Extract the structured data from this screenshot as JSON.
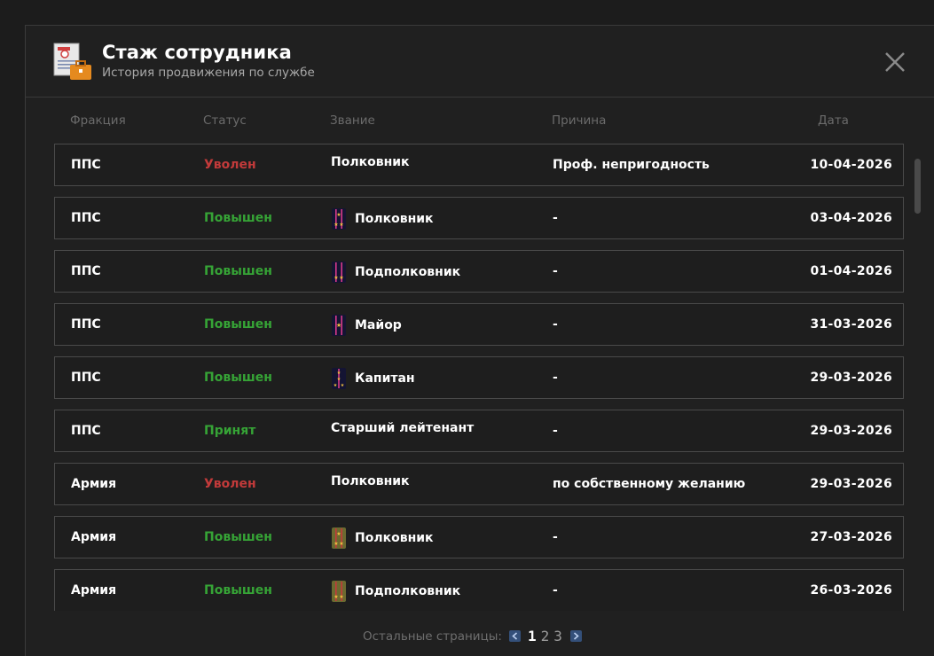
{
  "header": {
    "title": "Стаж сотрудника",
    "subtitle": "История продвижения по службе",
    "icon": "document-briefcase-icon"
  },
  "columns": {
    "faction": "Фракция",
    "status": "Статус",
    "rank": "Звание",
    "reason": "Причина",
    "date": "Дата"
  },
  "rows": [
    {
      "faction": "ППС",
      "status": "Уволен",
      "status_type": "fired",
      "rank": "Полковник",
      "rank_icon": "none",
      "reason": "Проф. непригодность",
      "date": "10-04-2026"
    },
    {
      "faction": "ППС",
      "status": "Повышен",
      "status_type": "promoted",
      "rank": "Полковник",
      "rank_icon": "police-colonel-epaulette",
      "reason": "-",
      "date": "03-04-2026"
    },
    {
      "faction": "ППС",
      "status": "Повышен",
      "status_type": "promoted",
      "rank": "Подполковник",
      "rank_icon": "police-lt-colonel-epaulette",
      "reason": "-",
      "date": "01-04-2026"
    },
    {
      "faction": "ППС",
      "status": "Повышен",
      "status_type": "promoted",
      "rank": "Майор",
      "rank_icon": "police-major-epaulette",
      "reason": "-",
      "date": "31-03-2026"
    },
    {
      "faction": "ППС",
      "status": "Повышен",
      "status_type": "promoted",
      "rank": "Капитан",
      "rank_icon": "police-captain-epaulette",
      "reason": "-",
      "date": "29-03-2026"
    },
    {
      "faction": "ППС",
      "status": "Принят",
      "status_type": "hired",
      "rank": "Старший лейтенант",
      "rank_icon": "none",
      "reason": "-",
      "date": "29-03-2026"
    },
    {
      "faction": "Армия",
      "status": "Уволен",
      "status_type": "fired",
      "rank": "Полковник",
      "rank_icon": "none",
      "reason": "по собственному желанию",
      "date": "29-03-2026"
    },
    {
      "faction": "Армия",
      "status": "Повышен",
      "status_type": "promoted",
      "rank": "Полковник",
      "rank_icon": "army-colonel-epaulette",
      "reason": "-",
      "date": "27-03-2026"
    },
    {
      "faction": "Армия",
      "status": "Повышен",
      "status_type": "promoted",
      "rank": "Подполковник",
      "rank_icon": "army-lt-colonel-epaulette",
      "reason": "-",
      "date": "26-03-2026"
    }
  ],
  "pager": {
    "label": "Остальные страницы:",
    "pages": [
      "1",
      "2",
      "3"
    ],
    "current": "1"
  },
  "colors": {
    "fired": "#c23a3a",
    "promoted": "#36a436",
    "hired": "#36a436"
  }
}
